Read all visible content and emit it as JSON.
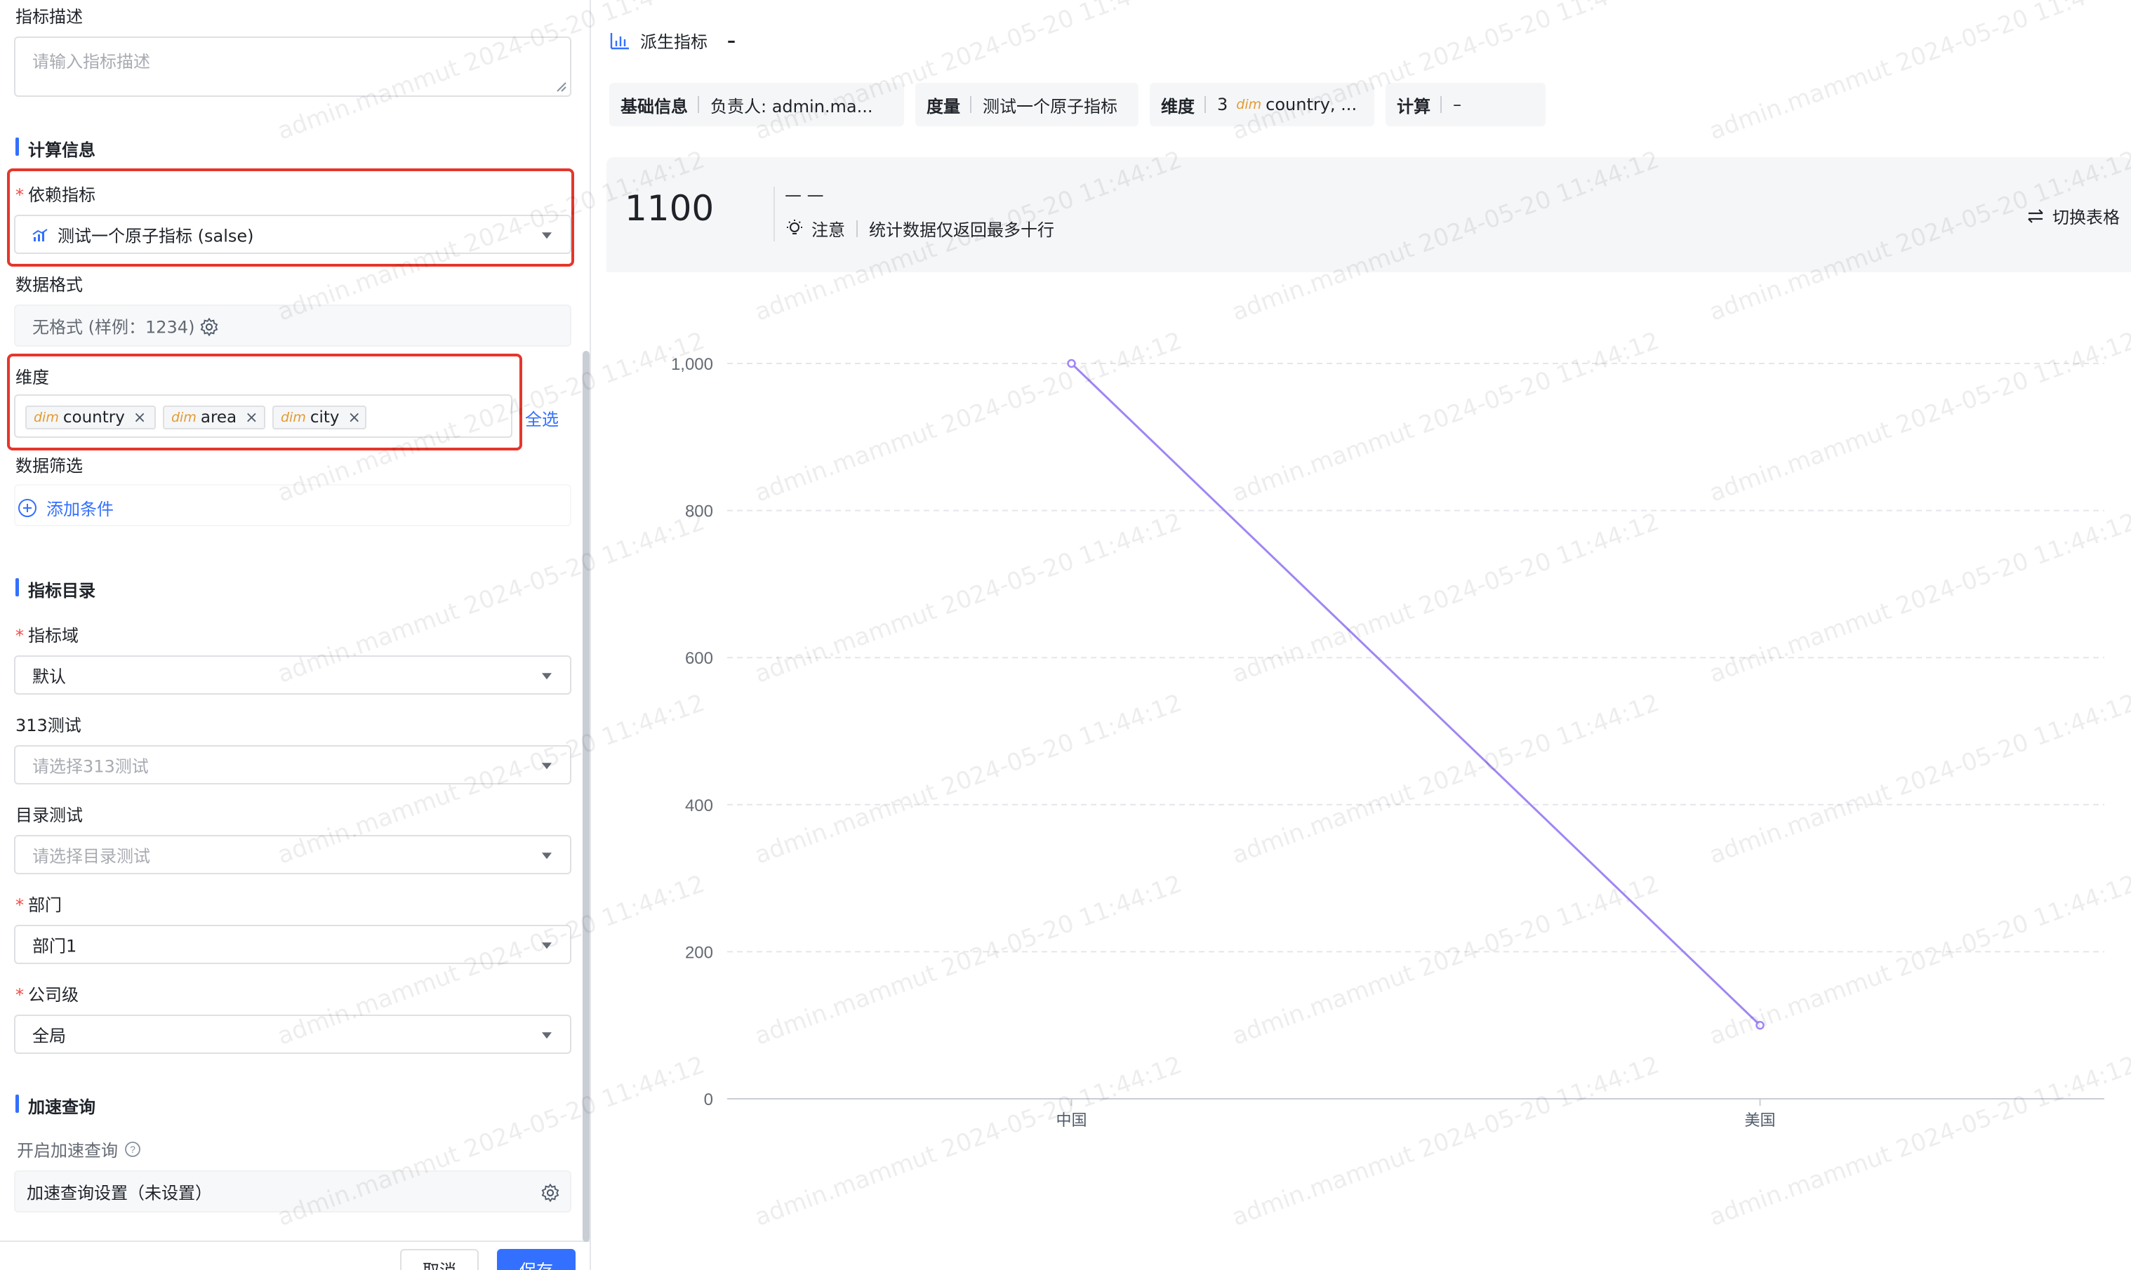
{
  "form": {
    "desc_label": "指标描述",
    "desc_placeholder": "请输入指标描述",
    "calc_section": "计算信息",
    "dep_label": "依赖指标",
    "dep_value": "测试一个原子指标 (salse)",
    "format_label": "数据格式",
    "format_value": "无格式 (样例：1234)",
    "dim_label": "维度",
    "dims": [
      {
        "prefix": "dim",
        "label": "country"
      },
      {
        "prefix": "dim",
        "label": "area"
      },
      {
        "prefix": "dim",
        "label": "city"
      }
    ],
    "select_all": "全选",
    "filter_label": "数据筛选",
    "add_condition": "添加条件",
    "catalog_section": "指标目录",
    "domain_label": "指标域",
    "domain_value": "默认",
    "test313_label": "313测试",
    "test313_placeholder": "请选择313测试",
    "catalog_test_label": "目录测试",
    "catalog_test_placeholder": "请选择目录测试",
    "dept_label": "部门",
    "dept_value": "部门1",
    "company_label": "公司级",
    "company_value": "全局",
    "accel_section": "加速查询",
    "accel_toggle_label": "开启加速查询",
    "accel_settings": "加速查询设置（未设置）",
    "cancel": "取消",
    "save": "保存"
  },
  "header": {
    "title": "派生指标",
    "title_suffix": "–"
  },
  "info_pills": [
    {
      "key": "基础信息",
      "value": "负责人:  admin.ma..."
    },
    {
      "key": "度量",
      "value": "测试一个原子指标"
    },
    {
      "key": "维度",
      "count": "3",
      "prefix": "dim",
      "value": "country, ..."
    },
    {
      "key": "计算",
      "value": "–"
    }
  ],
  "summary": {
    "total": "1100",
    "dash": "— —",
    "note_label": "注意",
    "note_text": "统计数据仅返回最多十行",
    "toggle_table": "切换表格"
  },
  "watermark_text": "admin.mammut 2024-05-20 11:44:12",
  "chart_data": {
    "type": "line",
    "categories": [
      "中国",
      "美国"
    ],
    "series": [
      {
        "values": [
          1000,
          100
        ]
      }
    ],
    "ylim": [
      0,
      1000
    ],
    "yticks": [
      "0",
      "200",
      "400",
      "600",
      "800",
      "1,000"
    ],
    "grid": true,
    "color": "#9f86f3"
  }
}
